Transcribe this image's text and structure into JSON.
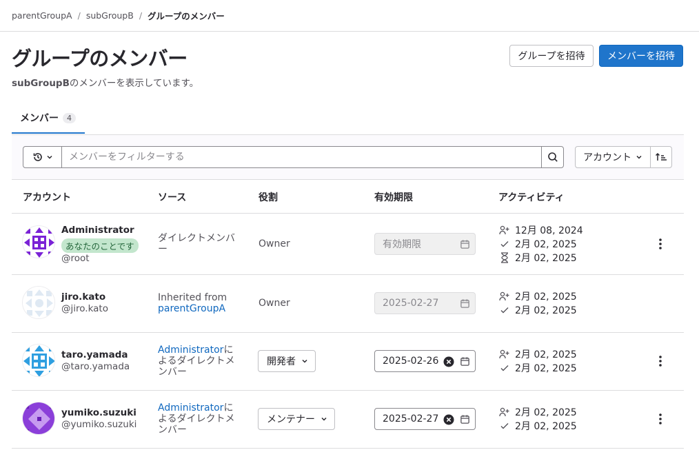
{
  "breadcrumb": {
    "items": [
      "parentGroupA",
      "subGroupB"
    ],
    "current": "グループのメンバー",
    "separator": "/"
  },
  "page": {
    "title": "グループのメンバー",
    "subtitle_bold": "subGroupB",
    "subtitle_rest": "のメンバーを表示しています。"
  },
  "buttons": {
    "invite_group": "グループを招待",
    "invite_members": "メンバーを招待"
  },
  "tabs": [
    {
      "label": "メンバー",
      "count": "4"
    }
  ],
  "filter": {
    "placeholder": "メンバーをフィルターする",
    "sort_label": "アカウント"
  },
  "table": {
    "headers": {
      "account": "アカウント",
      "source": "ソース",
      "role": "役割",
      "expiration": "有効期限",
      "activity": "アクティビティ"
    },
    "rows": [
      {
        "name": "Administrator",
        "you_badge": "あなたのことです",
        "username": "@root",
        "source_text": "ダイレクトメンバー",
        "role": "Owner",
        "expiration_placeholder": "有効期限",
        "activity": {
          "joined": "12月 08, 2024",
          "access": "2月 02, 2025",
          "last": "2月 02, 2025"
        }
      },
      {
        "name": "jiro.kato",
        "username": "@jiro.kato",
        "source_text": "Inherited from",
        "source_link": "parentGroupA",
        "role": "Owner",
        "expiration": "2025-02-27",
        "activity": {
          "joined": "2月 02, 2025",
          "access": "2月 02, 2025"
        }
      },
      {
        "name": "taro.yamada",
        "username": "@taro.yamada",
        "source_link": "Administrator",
        "source_text": "によるダイレクトメンバー",
        "role": "開発者",
        "expiration": "2025-02-26",
        "activity": {
          "joined": "2月 02, 2025",
          "access": "2月 02, 2025"
        }
      },
      {
        "name": "yumiko.suzuki",
        "username": "@yumiko.suzuki",
        "source_link": "Administrator",
        "source_text": "によるダイレクトメンバー",
        "role": "メンテナー",
        "expiration": "2025-02-27",
        "activity": {
          "joined": "2月 02, 2025",
          "access": "2月 02, 2025"
        }
      }
    ]
  },
  "colors": {
    "primary": "#1f75cb",
    "badge_bg": "#c3e6cd",
    "link": "#1068bf",
    "avatar_admin": "#7a22d6",
    "avatar_jiro": "#dfe9f3",
    "avatar_taro": "#2f9fe0",
    "avatar_yumiko": "#8b3fd9"
  }
}
